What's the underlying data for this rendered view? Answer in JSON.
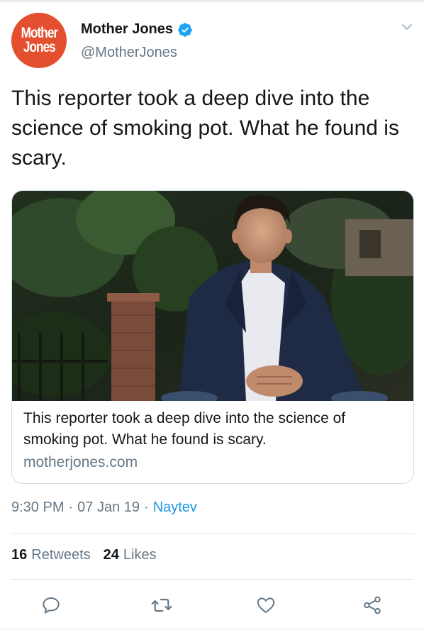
{
  "author": {
    "avatar_line1": "Mother",
    "avatar_line2": "Jones",
    "name": "Mother Jones",
    "handle": "@MotherJones",
    "verified": true
  },
  "tweet": {
    "text": "This reporter took a deep dive into the science of smoking pot. What he found is scary."
  },
  "card": {
    "title": "This reporter took a deep dive into the science of smoking pot. What he found is scary.",
    "domain": "motherjones.com"
  },
  "meta": {
    "time": "9:30 PM",
    "date": "07 Jan 19",
    "source": "Naytev",
    "separator": "·"
  },
  "stats": {
    "retweets_count": "16",
    "retweets_label": "Retweets",
    "likes_count": "24",
    "likes_label": "Likes"
  },
  "actions": [
    "reply-icon",
    "retweet-icon",
    "like-icon",
    "share-icon"
  ],
  "colors": {
    "brand_orange": "#e4502f",
    "verified_blue": "#1da1f2",
    "link_blue": "#1b95e0",
    "secondary_text": "#657786"
  }
}
